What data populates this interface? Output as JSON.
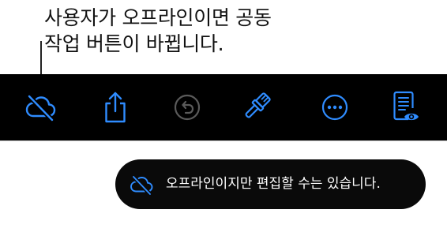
{
  "callout": {
    "line1": "사용자가 오프라인이면 공동",
    "line2": "작업 버튼이 바뀝니다."
  },
  "toolbar": {
    "background": "#000000",
    "accent": "#2f8cff",
    "disabled": "#5a5a5a",
    "buttons": [
      {
        "icon": "cloud-offline-icon",
        "enabled": true
      },
      {
        "icon": "share-icon",
        "enabled": true
      },
      {
        "icon": "undo-icon",
        "enabled": false
      },
      {
        "icon": "paintbrush-icon",
        "enabled": true
      },
      {
        "icon": "more-icon",
        "enabled": true
      },
      {
        "icon": "document-view-icon",
        "enabled": true
      }
    ]
  },
  "toast": {
    "icon": "cloud-offline-icon",
    "message": "오프라인이지만 편집할 수는 있습니다."
  }
}
